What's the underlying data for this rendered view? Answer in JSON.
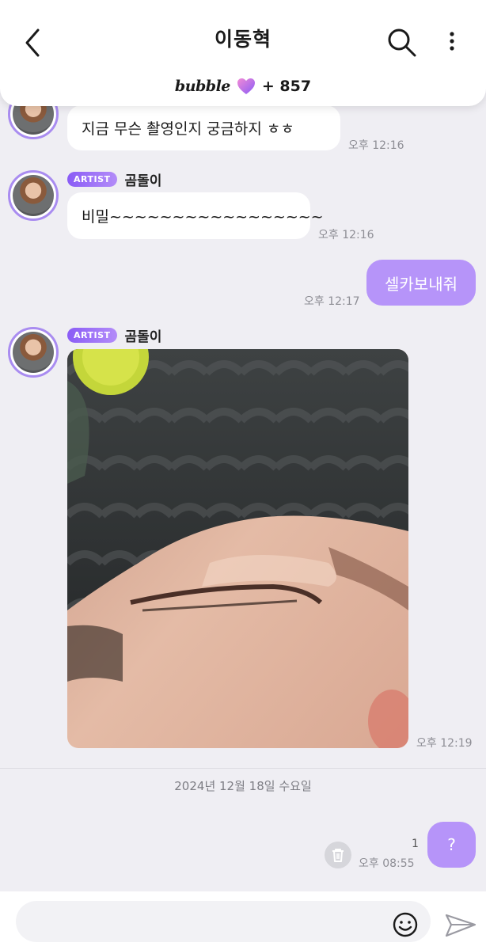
{
  "header": {
    "title": "이동혁",
    "bubble_logo": "bubble",
    "bubble_count": "+ 857",
    "icons": {
      "back": "chevron-left-icon",
      "search": "search-icon",
      "more": "more-vertical-icon",
      "heart": "purple-heart-icon"
    }
  },
  "artist": {
    "badge": "ARTIST",
    "name": "곰돌이"
  },
  "messages": [
    {
      "id": "m1",
      "sender": "artist",
      "text": "지금 무슨 촬영인지 궁금하지 ㅎㅎ",
      "time": "오후 12:16"
    },
    {
      "id": "m2",
      "sender": "artist",
      "text": "비밀~~~~~~~~~~~~~~~~~",
      "time": "오후 12:16"
    },
    {
      "id": "m3",
      "sender": "me",
      "text": "셀카보내줘",
      "time": "오후 12:17"
    },
    {
      "id": "m4",
      "sender": "artist",
      "type": "photo",
      "time": "오후 12:19"
    },
    {
      "id": "m5",
      "sender": "me",
      "text": "?",
      "time": "오후 08:55",
      "unread": "1"
    }
  ],
  "date_divider": "2024년 12월 18일 수요일",
  "input": {
    "placeholder": "",
    "icons": {
      "emoji": "smiley-icon",
      "send": "paper-plane-icon",
      "delete": "trash-icon"
    }
  },
  "colors": {
    "accent": "#b694f9",
    "background": "#efeef3",
    "badge": "#8a5cf6",
    "bubble_white": "#ffffff"
  }
}
